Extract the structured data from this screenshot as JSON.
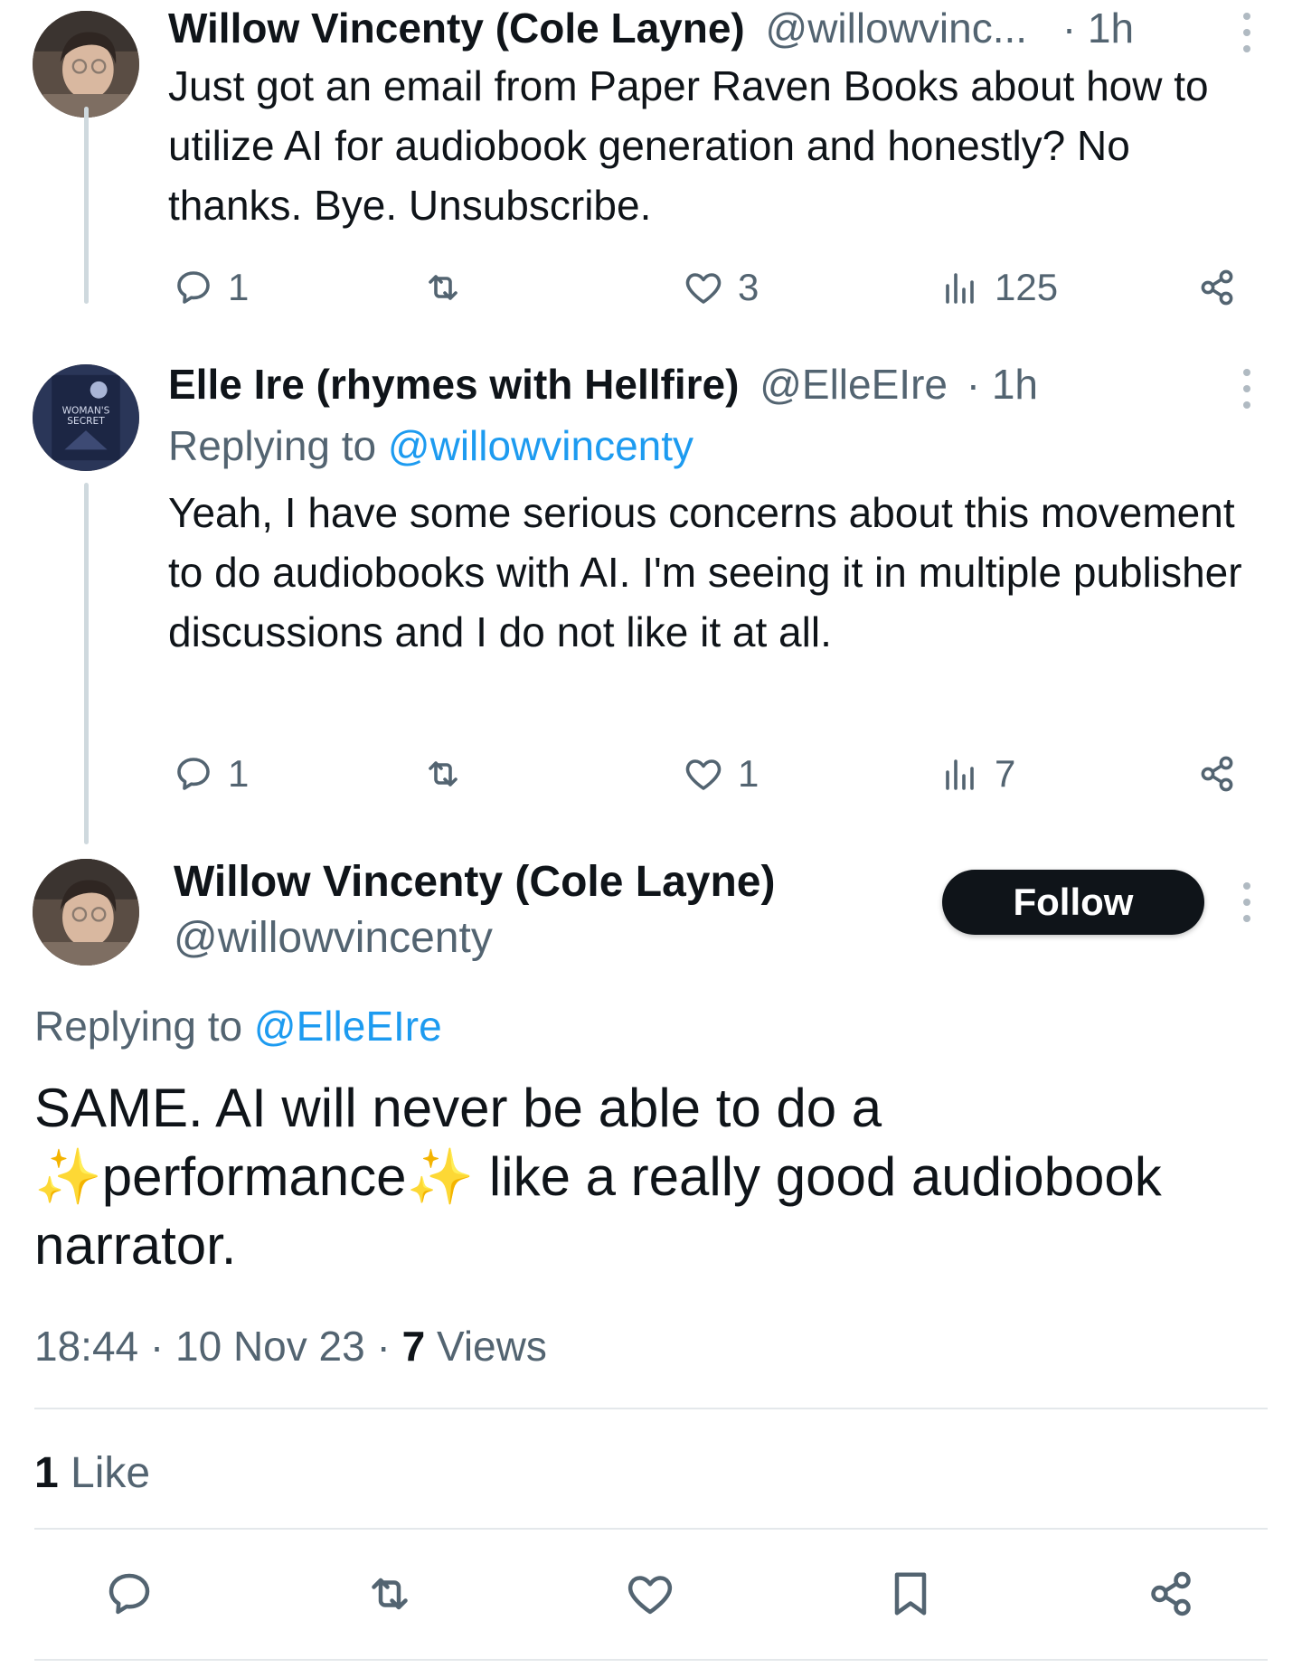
{
  "colors": {
    "link": "#1d9bf0",
    "muted": "#536471",
    "text": "#0f1419",
    "follow_bg": "#0f1419"
  },
  "tweet1": {
    "name": "Willow Vincenty (Cole Layne)",
    "handle": "@willowvinc...",
    "time": "· 1h",
    "text": "Just got an email from Paper Raven Books about how to utilize AI for audiobook generation and honestly? No thanks. Bye. Unsubscribe.",
    "replies": "1",
    "likes": "3",
    "views": "125"
  },
  "tweet2": {
    "name": "Elle Ire (rhymes with Hellfire)",
    "handle": "@ElleEIre",
    "time": "· 1h",
    "replying_prefix": "Replying to",
    "replying_to": "@willowvincenty",
    "text": "Yeah, I have some serious concerns about this movement to do audiobooks with AI. I'm seeing it in multiple publisher discussions and I do not like it at all.",
    "replies": "1",
    "likes": "1",
    "views": "7",
    "avatar_text": "WOMAN'S SECRET"
  },
  "main": {
    "name": "Willow Vincenty (Cole Layne)",
    "handle": "@willowvincenty",
    "follow_label": "Follow",
    "replying_prefix": "Replying to",
    "replying_to": "@ElleEIre",
    "text_part1": "SAME. AI will never be able to do a ",
    "sparkle1": "✨",
    "text_part2": "performance",
    "sparkle2": "✨",
    "text_part3": " like a really good audiobook narrator.",
    "time": "18:44",
    "date": "10 Nov 23",
    "views_count": "7",
    "views_label": "Views",
    "likes_count": "1",
    "likes_label": "Like"
  },
  "icons": {
    "reply": "reply-icon",
    "retweet": "retweet-icon",
    "like": "heart-icon",
    "views": "views-icon",
    "share": "share-icon",
    "bookmark": "bookmark-icon",
    "more": "more-icon"
  }
}
